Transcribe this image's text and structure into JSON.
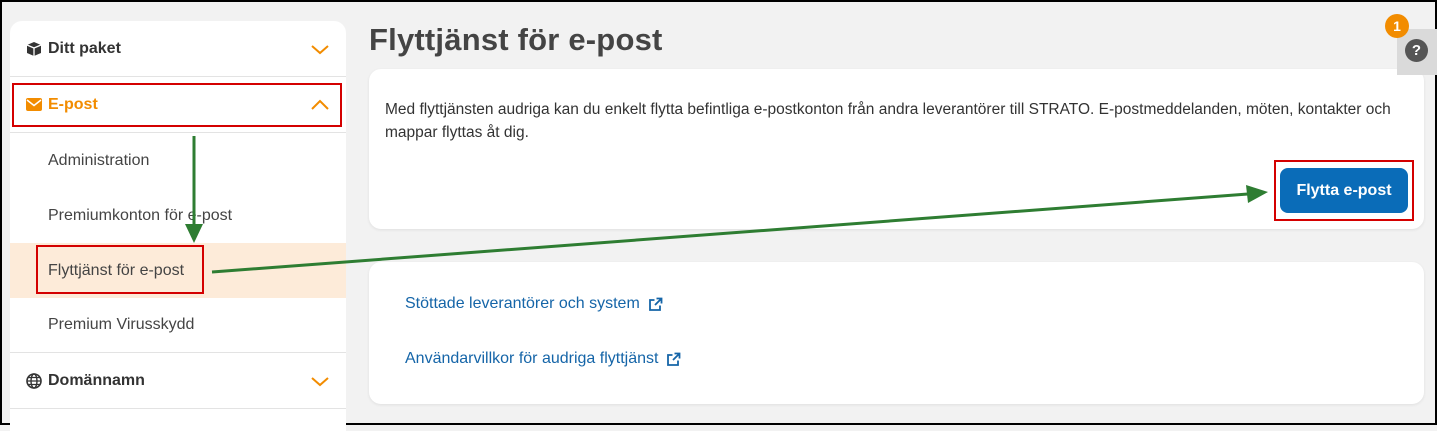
{
  "sidebar": {
    "items": [
      {
        "label": "Ditt paket",
        "icon": "box-icon"
      },
      {
        "label": "E-post",
        "icon": "envelope-icon"
      },
      {
        "label": "Domännamn",
        "icon": "globe-icon"
      }
    ],
    "email_subitems": [
      {
        "label": "Administration"
      },
      {
        "label": "Premiumkonton för e-post"
      },
      {
        "label": "Flyttjänst för e-post"
      },
      {
        "label": "Premium Virusskydd"
      }
    ]
  },
  "main": {
    "title": "Flyttjänst för e-post",
    "description": "Med flyttjänsten audriga kan du enkelt flytta befintliga e-postkonton från andra leverantörer till STRATO. E-postmeddelanden, möten, kontakter och mappar flyttas åt dig.",
    "button_label": "Flytta e-post",
    "links": [
      {
        "label": "Stöttade leverantörer och system",
        "icon": "external-link-icon"
      },
      {
        "label": "Användarvillkor för audriga flyttjänst",
        "icon": "external-link-icon"
      }
    ]
  },
  "help": {
    "icon_text": "?",
    "badge_count": "1"
  },
  "colors": {
    "accent": "#f28c00",
    "primary_button": "#0a6cb8",
    "link": "#1565a8",
    "annotation_red": "#d40000",
    "annotation_green": "#2e7d32",
    "selected_bg": "#fdebd9"
  }
}
